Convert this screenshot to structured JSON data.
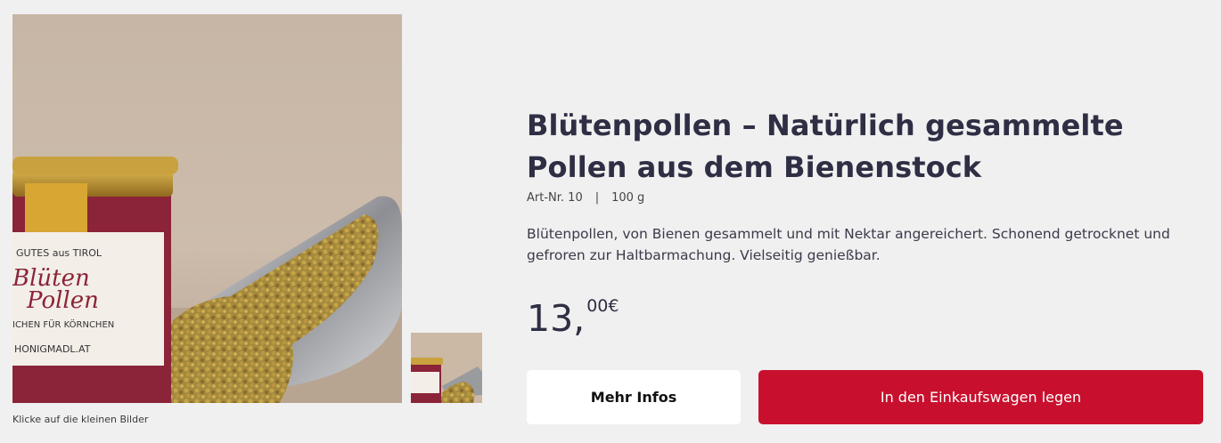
{
  "product": {
    "title": "Blütenpollen – Natürlich gesammelte Pollen aus dem Bienenstock",
    "art_nr": "Art-Nr. 10",
    "separator": "|",
    "weight": "100 g",
    "description": "Blütenpollen, von Bienen gesammelt und mit Nektar angereichert. Schonend getrocknet und gefroren zur Haltbarmachung. Vielseitig genießbar.",
    "price_main": "13,",
    "price_cents": "00€"
  },
  "gallery": {
    "caption": "Klicke auf die kleinen Bilder",
    "label_line1": "GUTES aus TIROL",
    "label_brand1": "Blüten",
    "label_brand2": "Pollen",
    "label_tagline": "ICHEN FÜR KÖRNCHEN",
    "label_url": "HONIGMADL.AT"
  },
  "buttons": {
    "more_info": "Mehr Infos",
    "add_to_cart": "In den Einkaufswagen legen"
  },
  "colors": {
    "accent": "#c8102e",
    "background": "#f0f0f0",
    "title": "#2e2e44"
  }
}
